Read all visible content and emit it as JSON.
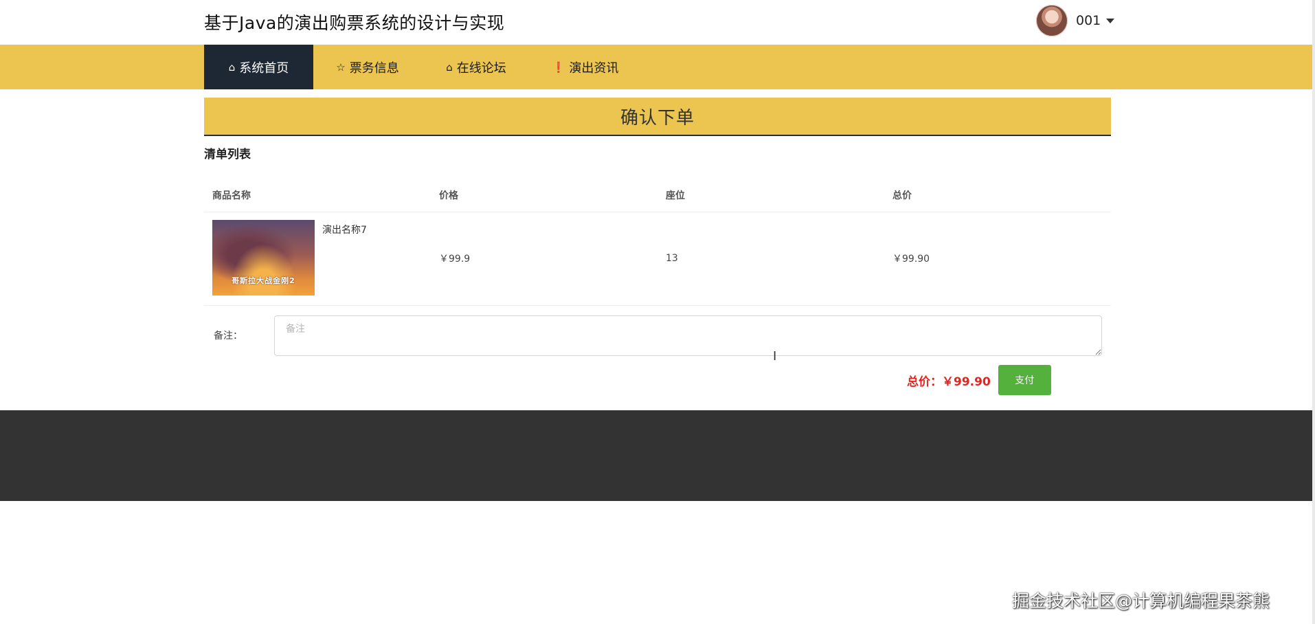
{
  "header": {
    "site_title": "基于Java的演出购票系统的设计与实现",
    "username": "001"
  },
  "nav": {
    "items": [
      {
        "label": "系统首页",
        "icon": "home-icon",
        "icon_glyph": "⌂",
        "active": true
      },
      {
        "label": "票务信息",
        "icon": "star-icon",
        "icon_glyph": "☆",
        "active": false
      },
      {
        "label": "在线论坛",
        "icon": "lock-icon",
        "icon_glyph": "⌂",
        "active": false
      },
      {
        "label": "演出资讯",
        "icon": "info-icon",
        "icon_glyph": "❗",
        "active": false
      }
    ]
  },
  "page": {
    "heading": "确认下单",
    "section_title": "清单列表"
  },
  "table": {
    "headers": [
      "商品名称",
      "价格",
      "座位",
      "总价"
    ],
    "rows": [
      {
        "name": "演出名称7",
        "price": "￥99.9",
        "seat": "13",
        "total": "￥99.90"
      }
    ]
  },
  "poster": {
    "title_text": "哥斯拉大战金刚2"
  },
  "remarks": {
    "label": "备注：",
    "placeholder": "备注",
    "value": ""
  },
  "summary": {
    "total_label": "总价：",
    "total_value": "￥99.90",
    "pay_label": "支付"
  },
  "watermark": {
    "text": "掘金技术社区@计算机编程果茶熊"
  },
  "colors": {
    "accent_yellow": "#ebc54f",
    "nav_active": "#1e2734",
    "total_red": "#e5231f",
    "pay_green": "#54b23c",
    "footer": "#333333"
  }
}
